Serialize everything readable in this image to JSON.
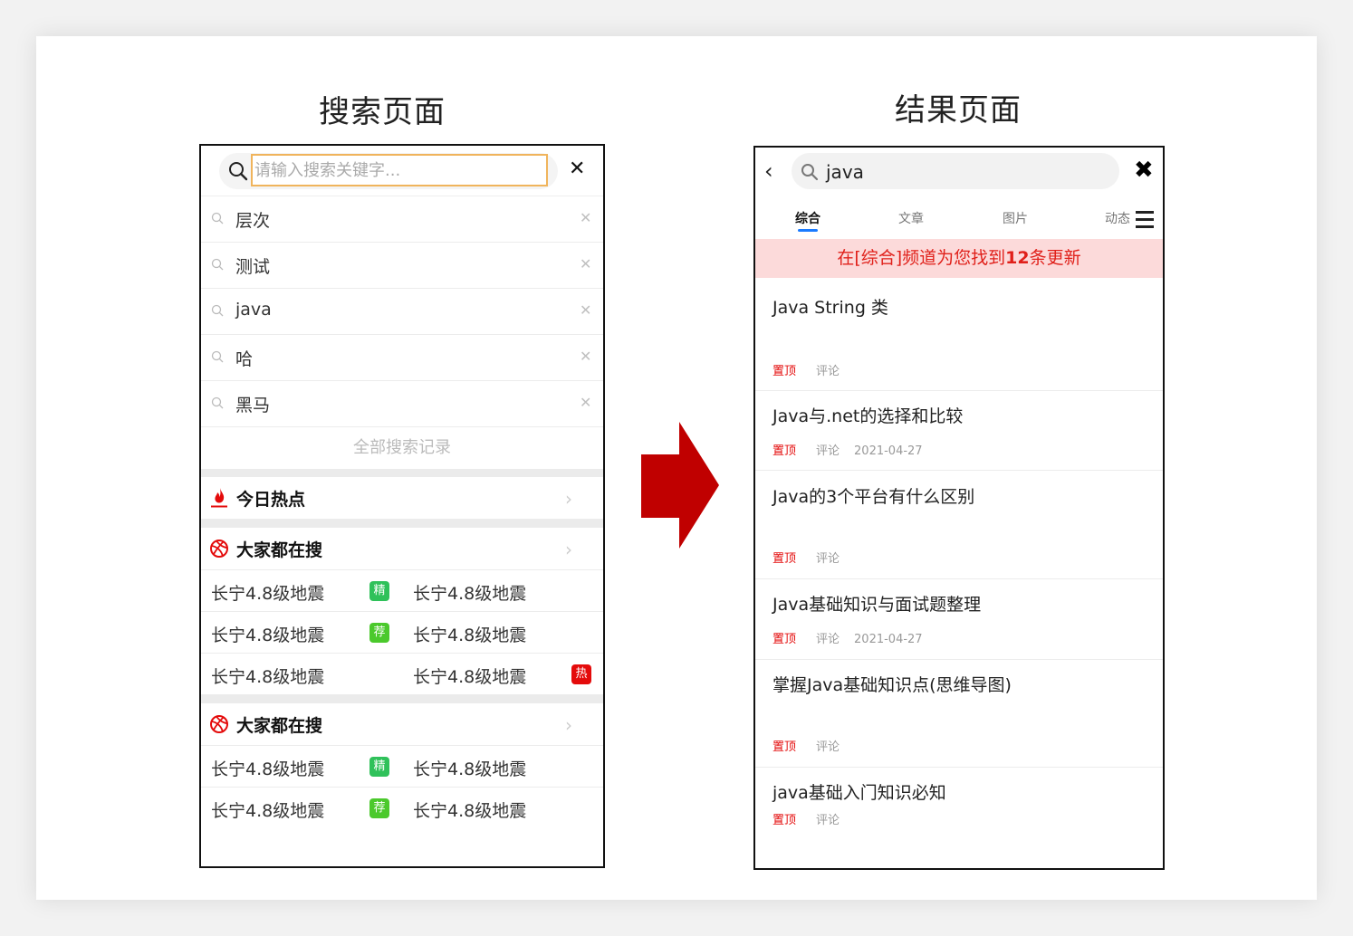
{
  "titles": {
    "left": "搜索页面",
    "right": "结果页面"
  },
  "search_page": {
    "placeholder": "请输入搜索关键字...",
    "history": [
      {
        "text": "层次"
      },
      {
        "text": "测试"
      },
      {
        "text": "java"
      },
      {
        "text": "哈"
      },
      {
        "text": "黑马"
      }
    ],
    "all_records": "全部搜索记录",
    "today_hot": "今日热点",
    "section1": {
      "title": "大家都在搜",
      "rows": [
        {
          "left": "长宁4.8级地震",
          "badge": "精",
          "right": "长宁4.8级地震",
          "right_badge": ""
        },
        {
          "left": "长宁4.8级地震",
          "badge": "荐",
          "right": "长宁4.8级地震",
          "right_badge": ""
        },
        {
          "left": "长宁4.8级地震",
          "badge": "",
          "right": "长宁4.8级地震",
          "right_badge": "热"
        }
      ]
    },
    "section2": {
      "title": "大家都在搜",
      "rows": [
        {
          "left": "长宁4.8级地震",
          "badge": "精",
          "right": "长宁4.8级地震"
        },
        {
          "left": "长宁4.8级地震",
          "badge": "荐",
          "right": "长宁4.8级地震"
        }
      ]
    }
  },
  "result_page": {
    "query": "java",
    "tabs": [
      "综合",
      "文章",
      "图片",
      "动态"
    ],
    "banner": {
      "prefix": "在[综合]频道为您找到",
      "count": "12",
      "suffix": "条更新"
    },
    "articles": [
      {
        "title": "Java String 类",
        "pin": "置顶",
        "comment": "评论",
        "date": ""
      },
      {
        "title": "Java与.net的选择和比较",
        "pin": "置顶",
        "comment": "评论",
        "date": "2021-04-27"
      },
      {
        "title": "Java的3个平台有什么区别",
        "pin": "置顶",
        "comment": "评论",
        "date": ""
      },
      {
        "title": "Java基础知识与面试题整理",
        "pin": "置顶",
        "comment": "评论",
        "date": "2021-04-27"
      },
      {
        "title": "掌握Java基础知识点(思维导图)",
        "pin": "置顶",
        "comment": "评论",
        "date": ""
      },
      {
        "title": "java基础入门知识必知",
        "pin": "置顶",
        "comment": "评论",
        "date": ""
      }
    ]
  },
  "colors": {
    "accent_red": "#e40b0b",
    "arrow": "#c00000",
    "tab_underline": "#1a7bff",
    "banner_bg": "#fcdada"
  }
}
